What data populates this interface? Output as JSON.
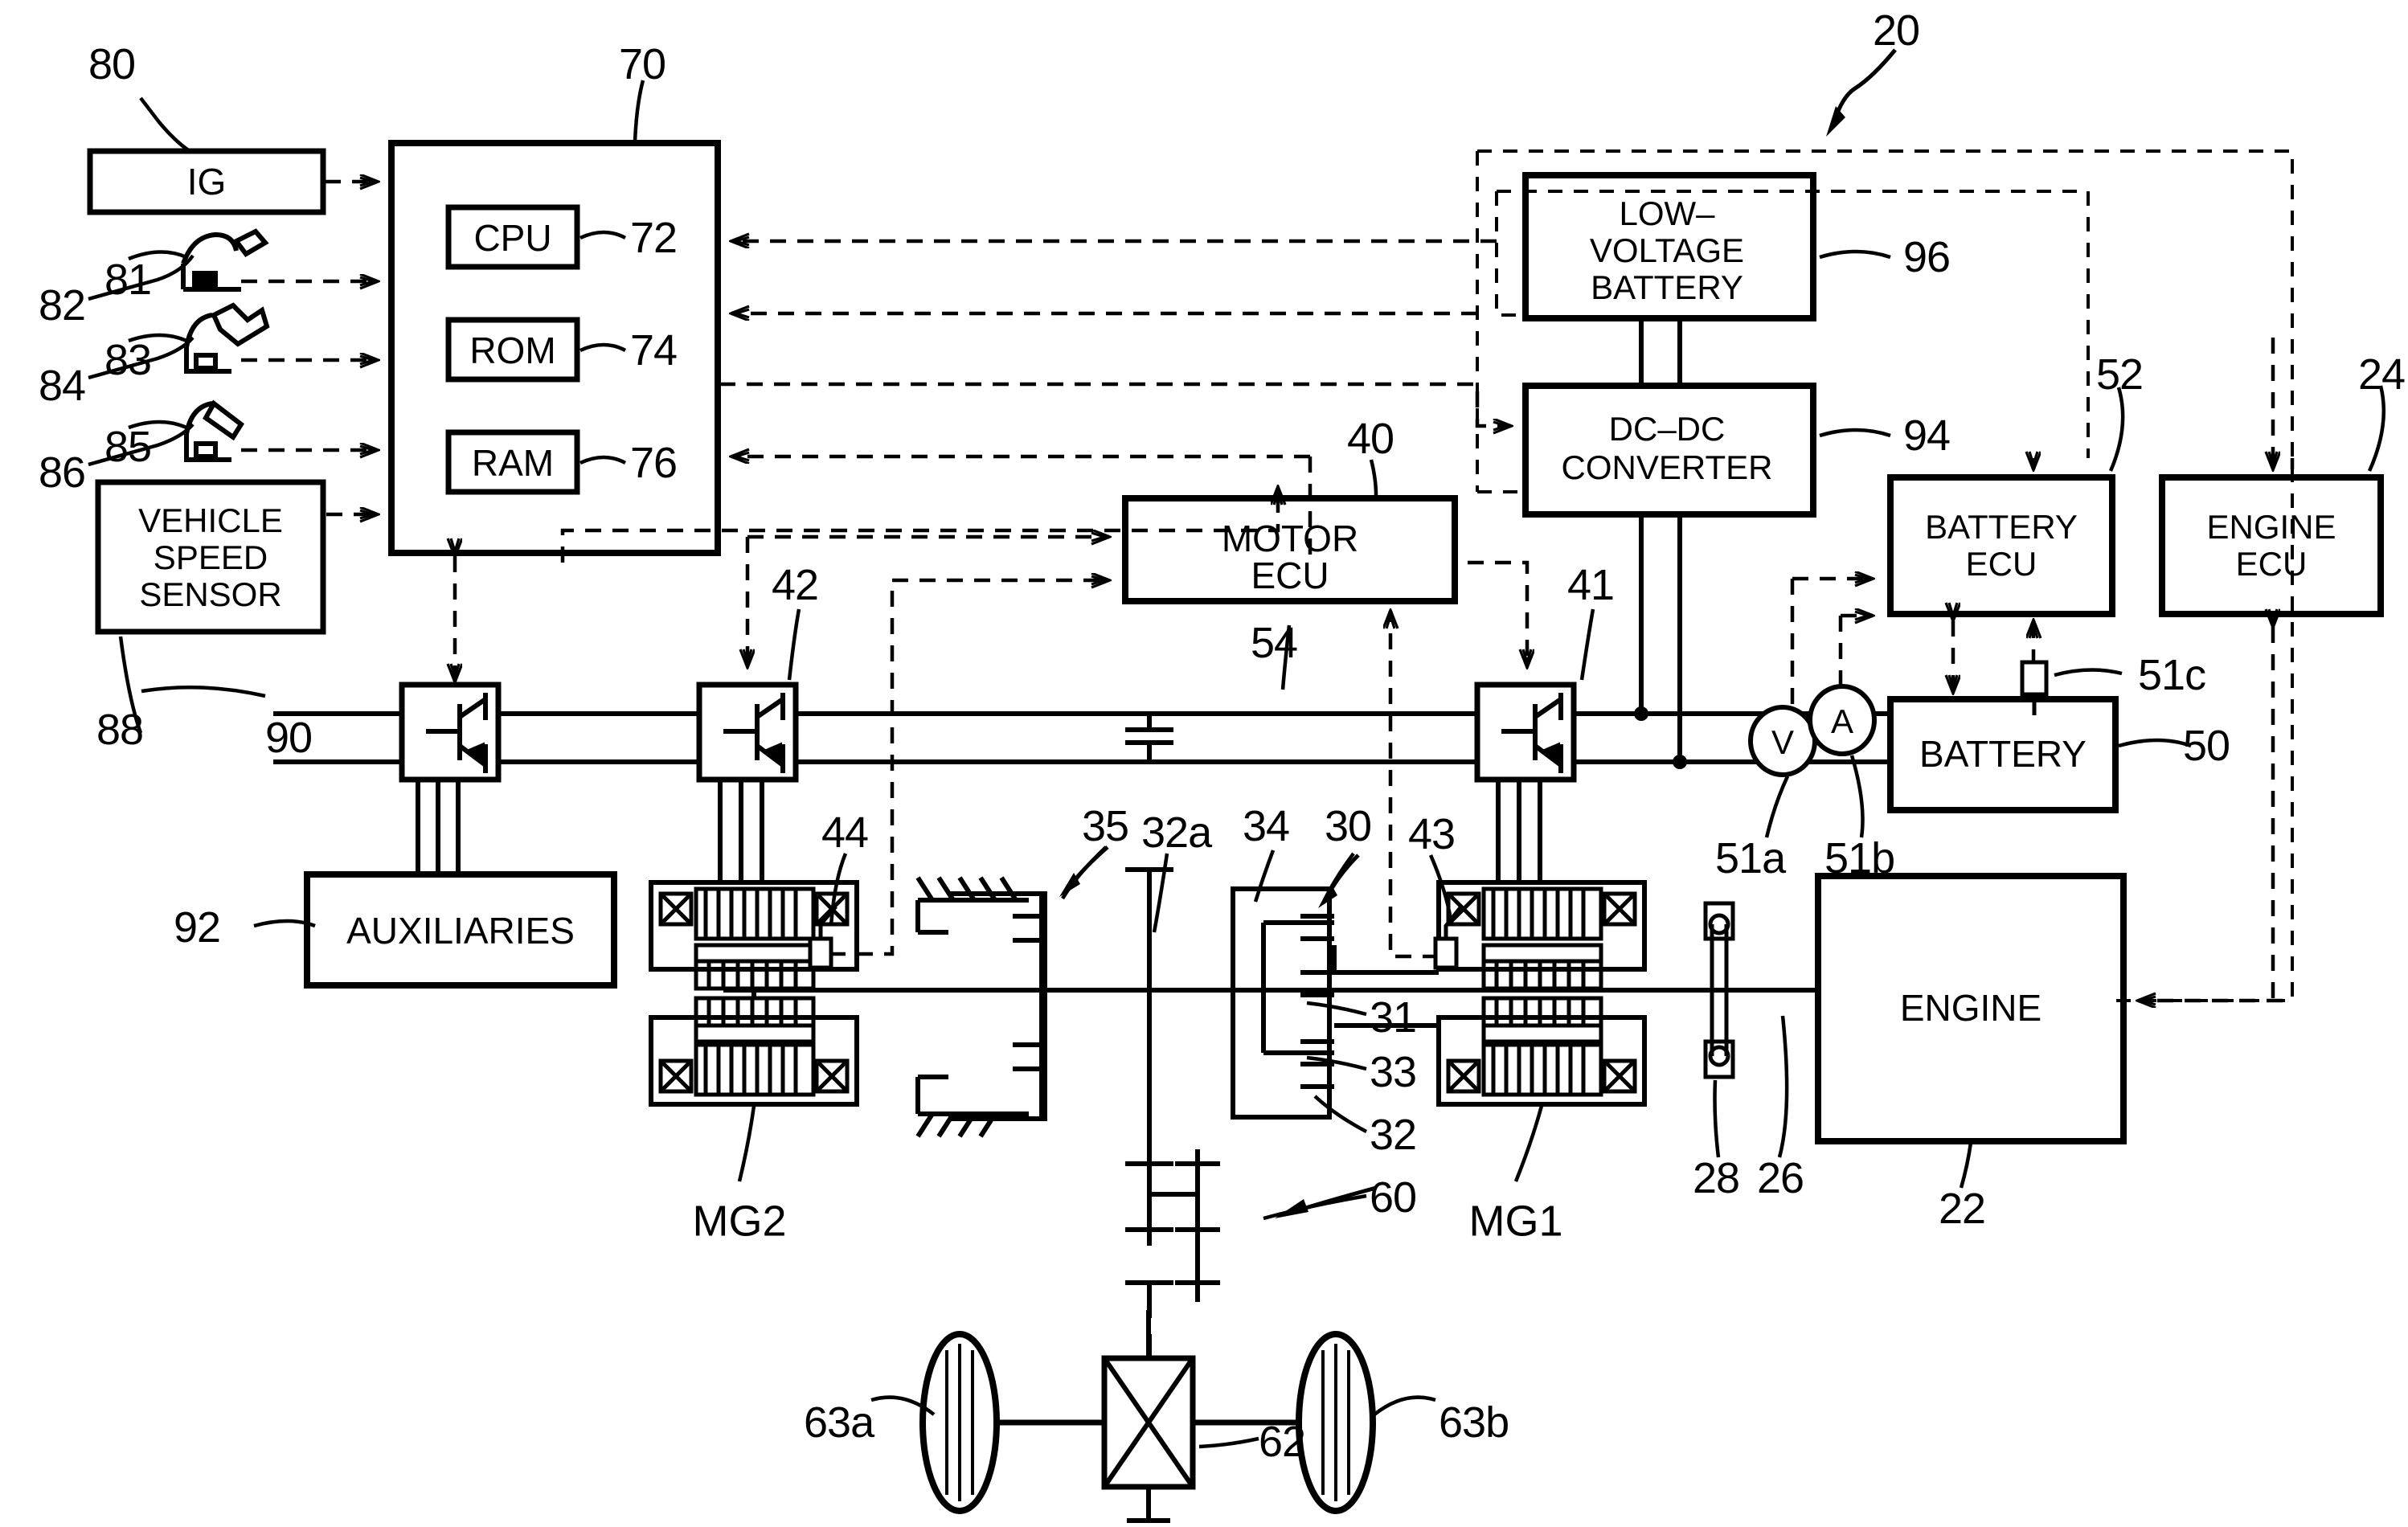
{
  "figure": {
    "type": "patent-block-diagram",
    "title": "Hybrid vehicle powertrain control block diagram",
    "system_ref": "20"
  },
  "boxes": {
    "ig": {
      "label": "IG",
      "ref": "80"
    },
    "vehicle_speed_sensor": {
      "line1": "VEHICLE",
      "line2": "SPEED",
      "line3": "SENSOR",
      "ref": "88"
    },
    "hybrid_ecu": {
      "ref": "70"
    },
    "cpu": {
      "label": "CPU",
      "ref": "72"
    },
    "rom": {
      "label": "ROM",
      "ref": "74"
    },
    "ram": {
      "label": "RAM",
      "ref": "76"
    },
    "motor_ecu": {
      "line1": "MOTOR",
      "line2": "ECU",
      "ref": "40",
      "ref2": "54"
    },
    "low_voltage_battery": {
      "line1": "LOW–",
      "line2": "VOLTAGE",
      "line3": "BATTERY",
      "ref": "96"
    },
    "dcdc_converter": {
      "line1": "DC–DC",
      "line2": "CONVERTER",
      "ref": "94"
    },
    "battery_ecu": {
      "line1": "BATTERY",
      "line2": "ECU",
      "ref": "52"
    },
    "engine_ecu": {
      "line1": "ENGINE",
      "line2": "ECU",
      "ref": "24"
    },
    "battery": {
      "label": "BATTERY",
      "ref": "50"
    },
    "engine": {
      "label": "ENGINE",
      "ref": "22"
    },
    "auxiliaries": {
      "label": "AUXILIARIES",
      "ref": "92"
    }
  },
  "refs": {
    "system": "20",
    "ig": "80",
    "accel_pedal_sensor": "81",
    "accel_pedal": "82",
    "brake_pedal_sensor": "83",
    "brake_pedal": "84",
    "shift_pedal_sensor": "85",
    "shift_pedal": "86",
    "vehicle_speed_sensor": "88",
    "hybrid_ecu": "70",
    "cpu": "72",
    "rom": "74",
    "ram": "76",
    "aux_inverter": "90",
    "auxiliaries": "92",
    "mg2_inverter": "42",
    "mg1_inverter": "41",
    "motor_ecu": "40",
    "motor_ecu_54": "54",
    "mg2_rotation_sensor": "44",
    "mg1_rotation_sensor": "43",
    "ring_gear": "35",
    "carrier_shaft": "32a",
    "planetary_gear": "34",
    "power_split": "30",
    "sun_gear": "31",
    "pinion_gear": "33",
    "carrier": "32",
    "gear_mechanism": "60",
    "differential": "62",
    "wheel_left": "63a",
    "wheel_right": "63b",
    "damper": "28",
    "crankshaft": "26",
    "engine": "22",
    "voltage_sensor": "51a",
    "current_sensor": "51b",
    "temperature_sensor": "51c",
    "battery": "50",
    "battery_ecu": "52",
    "engine_ecu": "24",
    "dcdc_converter": "94",
    "low_voltage_battery": "96"
  },
  "labels": {
    "mg1": "MG1",
    "mg2": "MG2",
    "voltmeter": "V",
    "ammeter": "A"
  },
  "colors": {
    "line": "#000000",
    "background": "#ffffff"
  }
}
